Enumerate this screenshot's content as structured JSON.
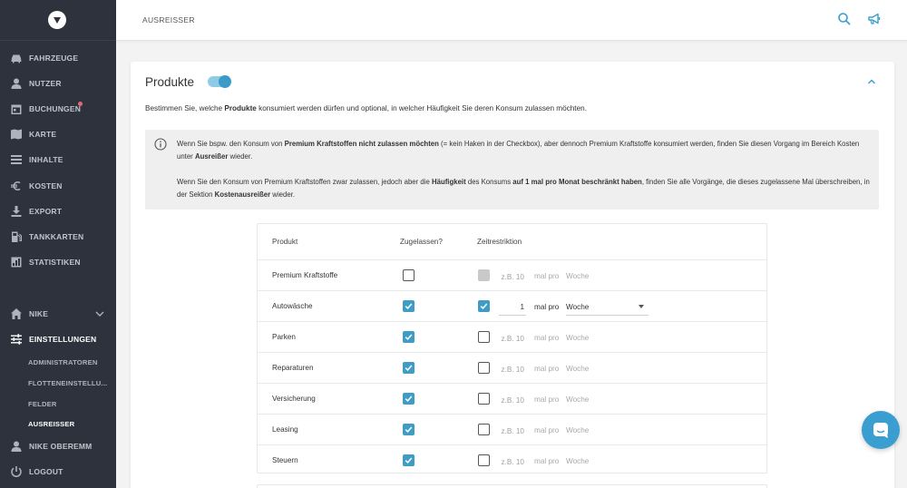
{
  "sidebar": {
    "items": [
      {
        "label": "FAHRZEUGE",
        "icon": "car-icon"
      },
      {
        "label": "NUTZER",
        "icon": "user-icon"
      },
      {
        "label": "BUCHUNGEN",
        "icon": "calendar-icon",
        "badge": true
      },
      {
        "label": "KARTE",
        "icon": "map-icon"
      },
      {
        "label": "INHALTE",
        "icon": "list-icon"
      },
      {
        "label": "KOSTEN",
        "icon": "euro-icon"
      },
      {
        "label": "EXPORT",
        "icon": "download-icon"
      },
      {
        "label": "TANKKARTEN",
        "icon": "fuel-icon"
      },
      {
        "label": "STATISTIKEN",
        "icon": "chart-icon"
      }
    ],
    "company": {
      "label": "NIKE",
      "icon": "home-icon"
    },
    "settings": {
      "label": "EINSTELLUNGEN",
      "icon": "sliders-icon"
    },
    "sub_items": [
      {
        "label": "ADMINISTRATOREN"
      },
      {
        "label": "FLOTTENEINSTELLU..."
      },
      {
        "label": "FELDER"
      },
      {
        "label": "AUSREISSER",
        "active": true
      }
    ],
    "user": {
      "label": "NIKE OBEREMM",
      "icon": "user-icon"
    },
    "logout": {
      "label": "LOGOUT",
      "icon": "power-icon"
    }
  },
  "header": {
    "breadcrumb": "AUSREISSER",
    "icons": [
      "search-icon",
      "megaphone-icon"
    ],
    "accent": "#3a9ed0"
  },
  "card": {
    "title": "Produkte",
    "toggle_on": true,
    "description": {
      "pre": "Bestimmen Sie, welche ",
      "bold": "Produkte",
      "post": " konsumiert werden dürfen und optional, in welcher Häufigkeit Sie deren Konsum zulassen möchten."
    },
    "info": {
      "p1_a": "Wenn Sie bspw. den Konsum von ",
      "p1_b": "Premium Kraftstoffen nicht zulassen möchten",
      "p1_c": " (= kein Haken in der Checkbox), aber dennoch Premium Kraftstoffe konsumiert werden, finden Sie diesen Vorgang im Bereich Kosten unter ",
      "p1_d": "Ausreißer",
      "p1_e": " wieder.",
      "p2_a": "Wenn Sie den Konsum von Premium Kraftstoffen zwar zulassen, jedoch aber die ",
      "p2_b": "Häufigkeit",
      "p2_c": " des Konsums ",
      "p2_d": "auf 1 mal pro Monat beschränkt haben",
      "p2_e": ", finden Sie alle Vorgänge, die dieses zugelassene Mal überschreiben, in der Sektion ",
      "p2_f": "Kostenausreißer",
      "p2_g": " wieder."
    }
  },
  "table": {
    "headers": {
      "product": "Produkt",
      "allowed": "Zugelassen?",
      "restriction": "Zeitrestriktion"
    },
    "mal_pro": "mal pro",
    "placeholder": "z.B. 10",
    "rows": [
      {
        "name": "Premium Kraftstoffe",
        "allowed": false,
        "restricted": false,
        "restriction_disabled": true,
        "count": "",
        "unit": "Woche"
      },
      {
        "name": "Autowäsche",
        "allowed": true,
        "restricted": true,
        "restriction_disabled": false,
        "count": "1",
        "unit": "Woche"
      },
      {
        "name": "Parken",
        "allowed": true,
        "restricted": false,
        "restriction_disabled": false,
        "count": "",
        "unit": "Woche"
      },
      {
        "name": "Reparaturen",
        "allowed": true,
        "restricted": false,
        "restriction_disabled": false,
        "count": "",
        "unit": "Woche"
      },
      {
        "name": "Versicherung",
        "allowed": true,
        "restricted": false,
        "restriction_disabled": false,
        "count": "",
        "unit": "Woche"
      },
      {
        "name": "Leasing",
        "allowed": true,
        "restricted": false,
        "restriction_disabled": false,
        "count": "",
        "unit": "Woche"
      },
      {
        "name": "Steuern",
        "allowed": true,
        "restricted": false,
        "restriction_disabled": false,
        "count": "",
        "unit": "Woche"
      }
    ]
  },
  "chat": {
    "icon": "chat-icon"
  }
}
